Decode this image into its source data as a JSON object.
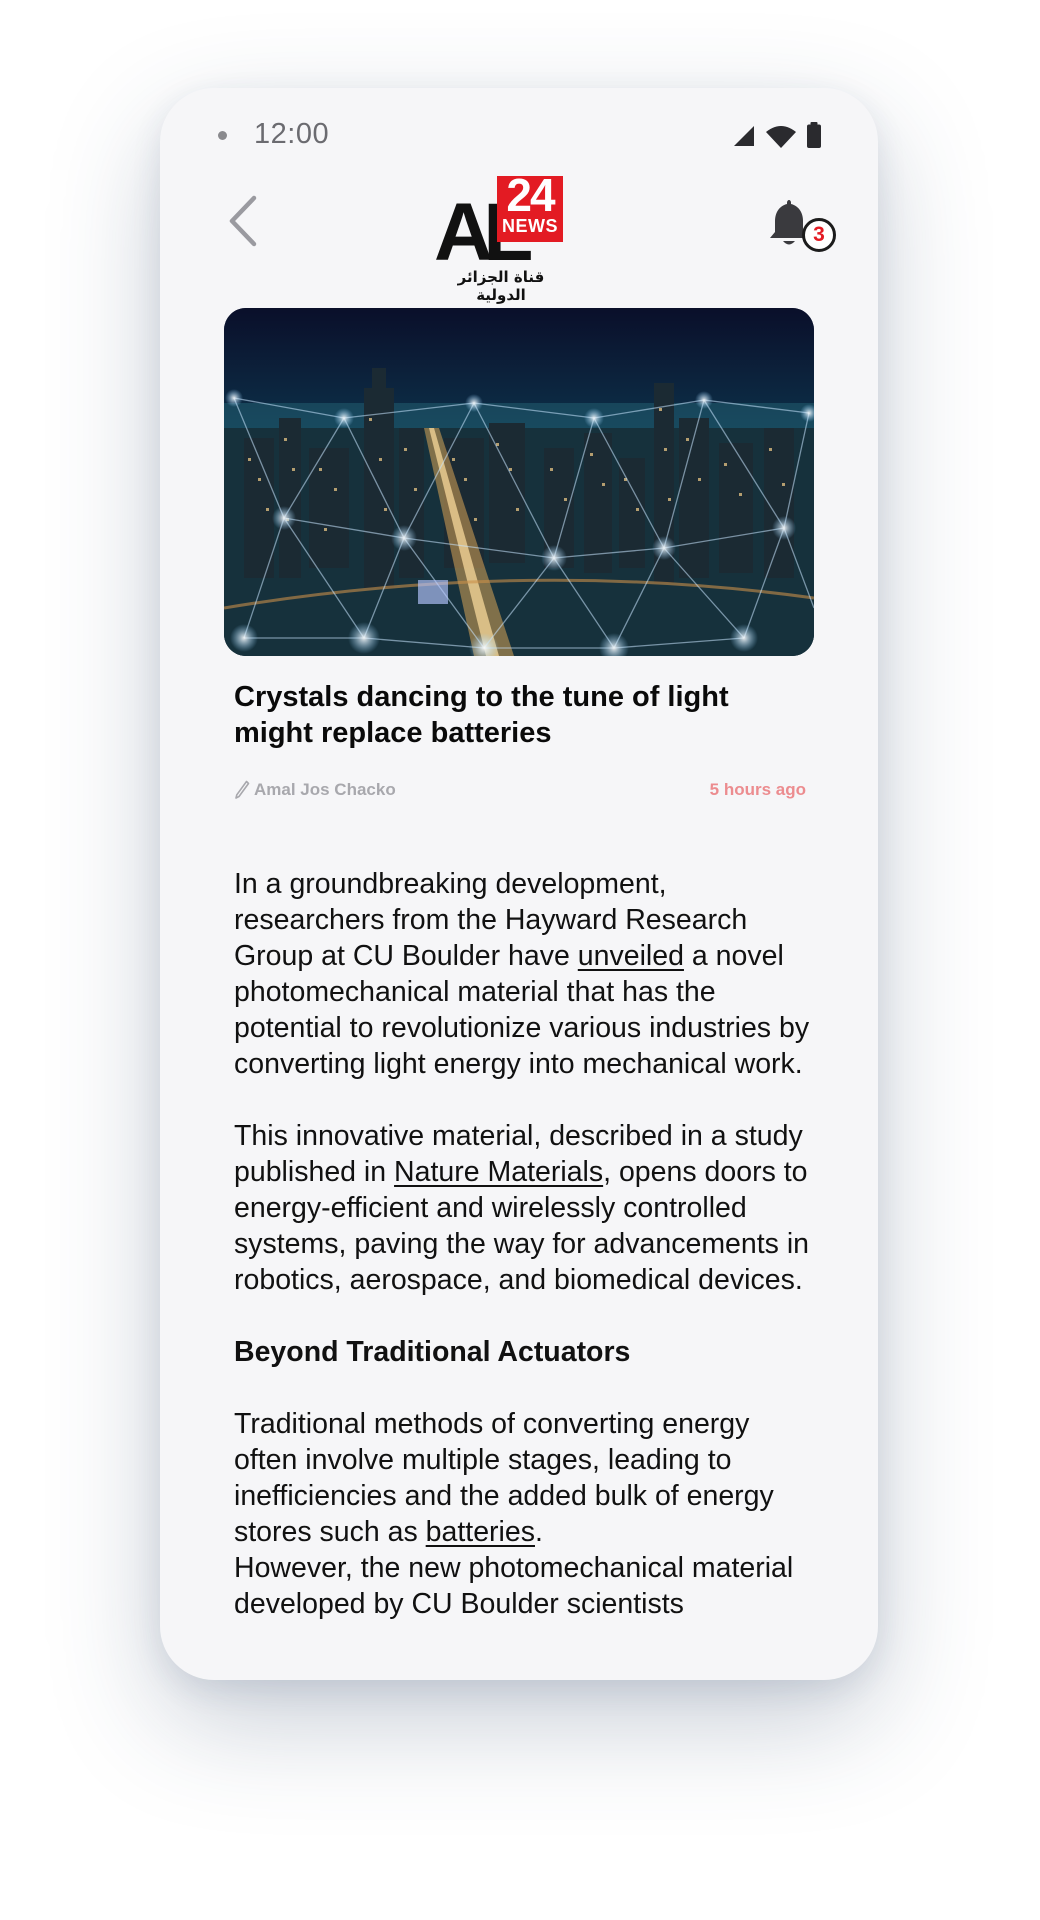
{
  "status_bar": {
    "time": "12:00"
  },
  "header": {
    "logo": {
      "brand_letters": "AL",
      "number": "24",
      "news": "NEWS",
      "tagline_arabic": "قناة الجزائر الدولية"
    },
    "notification_count": "3"
  },
  "article": {
    "title": "Crystals dancing to the tune of light might replace batteries",
    "author": "Amal Jos Chacko",
    "time_ago": "5 hours ago",
    "p1_a": "In a groundbreaking development, researchers from the Hayward Research Group at CU Boulder have ",
    "p1_link": "unveiled",
    "p1_b": " a novel photomechanical material that has the potential to revolutionize various industries by converting light energy into mechanical work.",
    "p2_a": "This innovative material, described in a study published in ",
    "p2_link": "Nature Materials",
    "p2_b": ", opens doors to energy-efficient and wirelessly controlled systems, paving the way for advancements in robotics, aerospace, and biomedical devices.",
    "subheading": "Beyond Traditional Actuators",
    "p3_a": "Traditional methods of converting energy often involve multiple stages, leading to inefficiencies and the added bulk of energy stores such as ",
    "p3_link": "batteries",
    "p3_b": ".",
    "p4": "However, the new photomechanical material developed by CU Boulder scientists"
  },
  "colors": {
    "brand_red": "#e31b23",
    "time_ago": "#ec8c8f",
    "author": "#a8a8ad",
    "background": "#f6f6f8"
  },
  "icons": [
    "back-chevron-icon",
    "bell-icon",
    "signal-icon",
    "wifi-icon",
    "battery-icon",
    "pencil-icon"
  ]
}
